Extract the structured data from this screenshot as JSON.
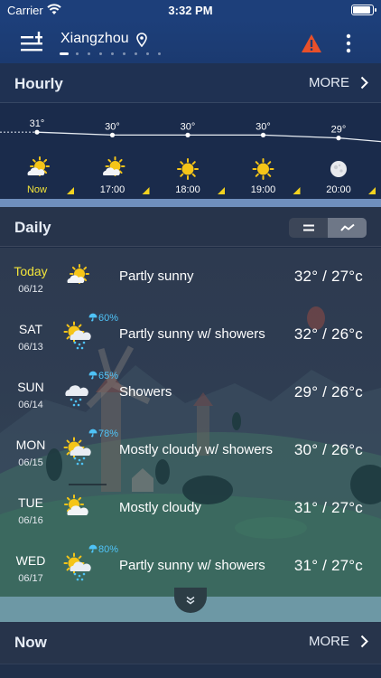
{
  "status_bar": {
    "carrier": "Carrier",
    "time": "3:32 PM"
  },
  "header": {
    "city": "Xiangzhou",
    "page_count": 9,
    "active_page": 0
  },
  "hourly": {
    "title": "Hourly",
    "more_label": "MORE",
    "items": [
      {
        "time": "Now",
        "temp": "31°",
        "icon": "partly-sunny-icon",
        "highlight": true
      },
      {
        "time": "17:00",
        "temp": "30°",
        "icon": "partly-sunny-icon"
      },
      {
        "time": "18:00",
        "temp": "30°",
        "icon": "sunny-icon"
      },
      {
        "time": "19:00",
        "temp": "30°",
        "icon": "sunny-icon"
      },
      {
        "time": "20:00",
        "temp": "29°",
        "icon": "moon-icon"
      }
    ]
  },
  "daily": {
    "title": "Daily",
    "view_modes": [
      "list",
      "chart"
    ],
    "active_view": "chart",
    "days": [
      {
        "name": "Today",
        "date": "06/12",
        "condition": "Partly sunny",
        "temp": "32° / 27°c",
        "precip": "",
        "icon": "partly-sunny-icon",
        "today": true
      },
      {
        "name": "SAT",
        "date": "06/13",
        "condition": "Partly sunny w/ showers",
        "temp": "32° / 26°c",
        "precip": "60%",
        "icon": "sun-rain-icon"
      },
      {
        "name": "SUN",
        "date": "06/14",
        "condition": "Showers",
        "temp": "29° / 26°c",
        "precip": "65%",
        "icon": "cloud-rain-icon"
      },
      {
        "name": "MON",
        "date": "06/15",
        "condition": "Mostly cloudy w/ showers",
        "temp": "30° / 26°c",
        "precip": "78%",
        "icon": "sun-rain-icon"
      },
      {
        "name": "TUE",
        "date": "06/16",
        "condition": "Mostly cloudy",
        "temp": "31° / 27°c",
        "precip": "",
        "icon": "mostly-cloudy-icon"
      },
      {
        "name": "WED",
        "date": "06/17",
        "condition": "Partly sunny w/ showers",
        "temp": "31° / 27°c",
        "precip": "80%",
        "icon": "sun-rain-icon"
      }
    ]
  },
  "now": {
    "title": "Now",
    "more_label": "MORE"
  },
  "colors": {
    "today_label": "#f3e43a",
    "precip": "#4fc3f7",
    "warning": "#e8502a",
    "sun": "#f5c518",
    "hour_marker": "#f3d21f"
  }
}
